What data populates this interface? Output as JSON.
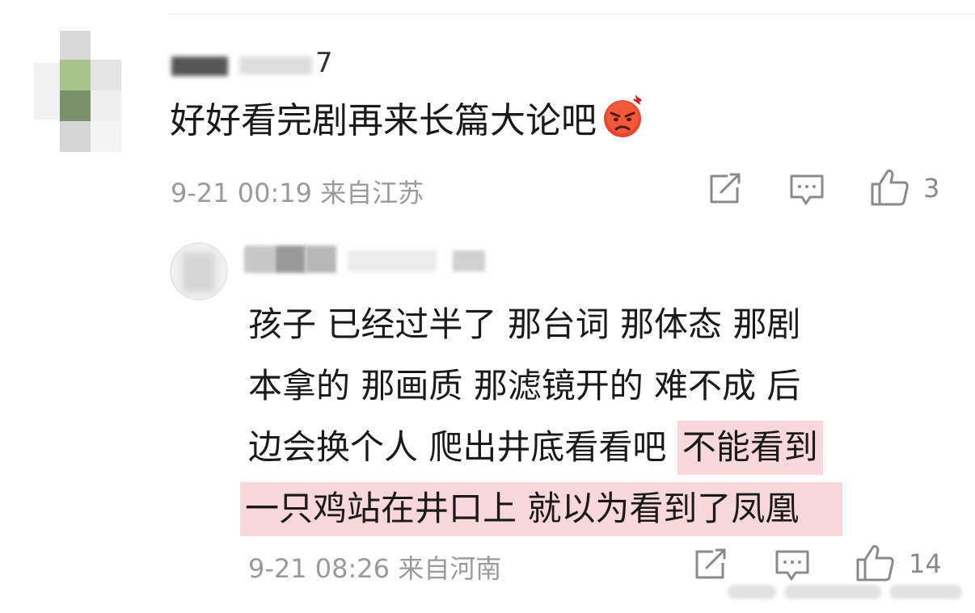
{
  "comment": {
    "username_suffix": "7",
    "text": "好好看完剧再来长篇大论吧",
    "emoji": "angry-face-icon",
    "date": "9-21 00:19",
    "location": "来自江苏",
    "like_count": "3"
  },
  "reply": {
    "text_line1": "孩子 已经过半了 那台词 那体态 那剧",
    "text_line2": "本拿的 那画质 那滤镜开的 难不成 后",
    "text_line3_normal": "边会换个人 爬出井底看看吧",
    "text_line3_highlight": "不能看到",
    "text_line4_highlight": "一只鸡站在井口上 就以为看到了凤凰",
    "date": "9-21 08:26",
    "location": "来自河南",
    "like_count": "14"
  },
  "colors": {
    "highlight": "#f9d8dc",
    "meta_text": "#9a9a9a",
    "emoji_red": "#e8452c"
  }
}
